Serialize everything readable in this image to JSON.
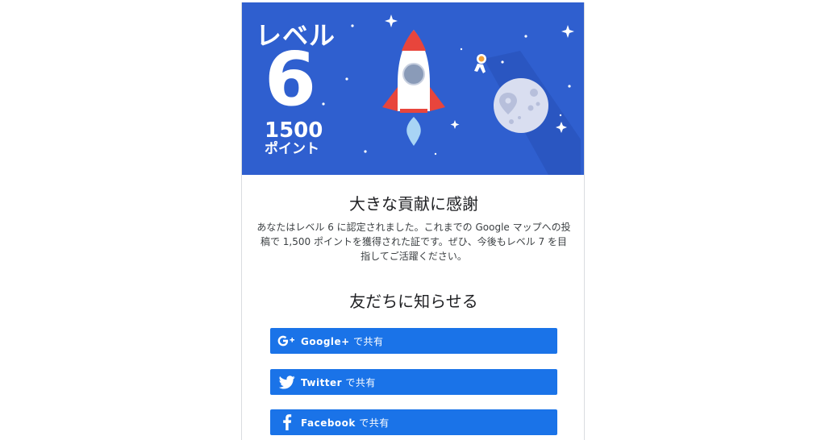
{
  "badge": {
    "level_word": "レベル",
    "level_number": "6",
    "points_number": "1500",
    "points_unit": "ポイント"
  },
  "content": {
    "heading": "大きな貢献に感謝",
    "message": "あなたはレベル 6 に認定されました。これまでの Google マップへの投稿で 1,500 ポイントを獲得された証です。ぜひ、今後もレベル 7 を目指してご活躍ください。",
    "share_heading": "友だちに知らせる"
  },
  "share_buttons": [
    {
      "service": "Google+",
      "suffix": " で共有",
      "icon": "google-plus-icon"
    },
    {
      "service": "Twitter",
      "suffix": " で共有",
      "icon": "twitter-icon"
    },
    {
      "service": "Facebook",
      "suffix": " で共有",
      "icon": "facebook-icon"
    }
  ],
  "colors": {
    "hero_bg": "#2f5fcf",
    "button_bg": "#1a73e8",
    "rocket_red": "#e8453c",
    "moon": "#d9def0"
  }
}
